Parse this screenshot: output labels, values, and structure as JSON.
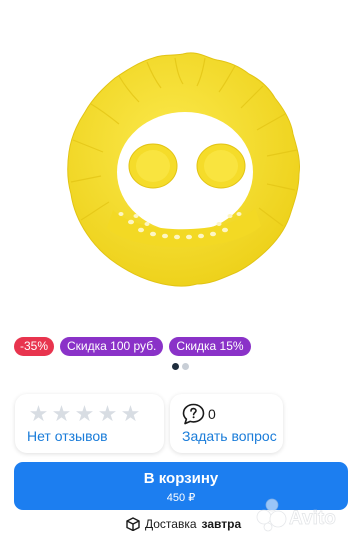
{
  "product": {
    "image_icon": "yellow-baby-shower-cap",
    "image_color": "#f7e13a"
  },
  "badges": [
    {
      "label": "-35%",
      "color": "#e8344e"
    },
    {
      "label": "Скидка 100 руб.",
      "color": "#8a32c8"
    },
    {
      "label": "Скидка 15%",
      "color": "#8a32c8"
    }
  ],
  "gallery": {
    "current_slide": 1,
    "total_slides": 2
  },
  "reviews": {
    "rating_stars": 0,
    "max_stars": 5,
    "link_label": "Нет отзывов"
  },
  "questions": {
    "count": "0",
    "link_label": "Задать вопрос"
  },
  "cart": {
    "label": "В корзину",
    "price": "450 ₽",
    "color": "#1c7ef0"
  },
  "delivery": {
    "prefix": "Доставка",
    "when": "завтра"
  },
  "watermark": {
    "brand": "Avito"
  }
}
